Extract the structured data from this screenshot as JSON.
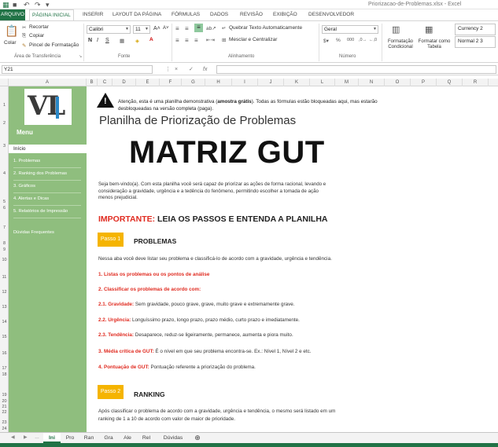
{
  "window": {
    "title": "Priorizacao-de-Problemas.xlsx - Excel"
  },
  "ribbon": {
    "tabs": [
      "ARQUIVO",
      "PÁGINA INICIAL",
      "INSERIR",
      "LAYOUT DA PÁGINA",
      "FÓRMULAS",
      "DADOS",
      "REVISÃO",
      "EXIBIÇÃO",
      "DESENVOLVEDOR"
    ],
    "clipboard": {
      "paste": "Colar",
      "cut": "Recortar",
      "copy": "Copiar",
      "format_painter": "Pincel de Formatação",
      "label": "Área de Transferência"
    },
    "font": {
      "name": "Calibri",
      "size": "11",
      "bold": "N",
      "italic": "I",
      "underline": "S",
      "label": "Fonte"
    },
    "alignment": {
      "wrap": "Quebrar Texto Automaticamente",
      "merge": "Mesclar e Centralizar",
      "label": "Alinhamento"
    },
    "number": {
      "format": "Geral",
      "label": "Número"
    },
    "styles": {
      "conditional": "Formatação Condicional",
      "as_table": "Formatar como Tabela",
      "style1": "Currency 2",
      "style2": "Normal 2 3"
    }
  },
  "formula_bar": {
    "name_box": "Y21",
    "cancel": "×",
    "enter": "✓",
    "fx": "fx"
  },
  "columns": [
    "A",
    "B",
    "C",
    "D",
    "E",
    "F",
    "G",
    "H",
    "I",
    "J",
    "K",
    "L",
    "M",
    "N",
    "O",
    "P",
    "Q",
    "R"
  ],
  "rows": [
    "1",
    "2",
    "3",
    "4",
    "5",
    "6",
    "7",
    "8",
    "9",
    "10",
    "11",
    "12",
    "13",
    "14",
    "15",
    "16",
    "17",
    "18",
    "19",
    "20",
    "21",
    "22",
    "23",
    "24"
  ],
  "sidebar": {
    "logo": "VL",
    "menu_title": "Menu",
    "active": "Início",
    "items": [
      "1. Problemas",
      "2. Ranking dos Problemas",
      "3. Gráficos",
      "4. Alertas e Dicas",
      "5. Relatórios de Impressão"
    ],
    "faq": "Dúvidas Frequentes"
  },
  "main": {
    "warning_pre": "Atenção, esta é uma planilha demonstrativa (",
    "warning_bold": "amostra grátis",
    "warning_post": "). Todas as fórmulas estão bloqueadas aqui, mas estarão desbloqueadas na versão completa (paga).",
    "sheet_title": "Planilha de Priorização de Problemas",
    "big_title": "MATRIZ GUT",
    "intro": "Seja bem-vindo(a). Com esta planilha você será capaz de priorizar as ações de forma racional, levando e consideração a gravidade, urgência e a tedência do fenômeno, permitindo escolher a tomada de ação menos prejudicial.",
    "important_red": "IMPORTANTE:",
    "important_rest": " LEIA OS PASSOS E ENTENDA A PLANILHA",
    "step1": {
      "badge": "Passo 1",
      "heading": "PROBLEMAS"
    },
    "step1_desc": "Nessa aba você deve listar seu problema e classificá-lo de acordo com a gravidade, urgência e tendência.",
    "list1": "1. Listas os problemas ou os pontos de análise",
    "list2": "2. Classificar os problemas de acordo com:",
    "g_label": "2.1. Gravidade:",
    "g_text": " Sem gravidade, pouco grave, grave, muito grave e extremamente grave.",
    "u_label": "2.2. Urgência:",
    "u_text": " Longuíssimo prazo, longo prazo, prazo médio, curto prazo e imediatamente.",
    "t_label": "2.3. Tendência:",
    "t_text": " Desaparece, reduz-se ligeiramente, permanece, aumenta e piora muito.",
    "m_label": "3. Média crítica de GUT:",
    "m_text": " É o nível em que seu problema encontra-se. Ex.: Nível 1, Nível 2 e etc.",
    "p_label": "4. Pontuação de GUT:",
    "p_text": " Pontuação referente a priorização do problema.",
    "step2": {
      "badge": "Passo 2",
      "heading": "RANKING"
    },
    "step2_desc1": "Após classificar o problema de acordo com a gravidade, urgência e tendência, o mesmo será listado  em um",
    "step2_desc2": "ranking de 1 a 10 de acordo com valor de maior de prioridade."
  },
  "sheet_tabs": [
    "Ini",
    "Pro",
    "Ran",
    "Gra",
    "Ale",
    "Rel",
    "Dúvidas"
  ],
  "colors": {
    "excel_green": "#217346",
    "sidebar_green": "#8fbe7e",
    "accent_red": "#e02b20",
    "badge_yellow": "#f5b400"
  }
}
